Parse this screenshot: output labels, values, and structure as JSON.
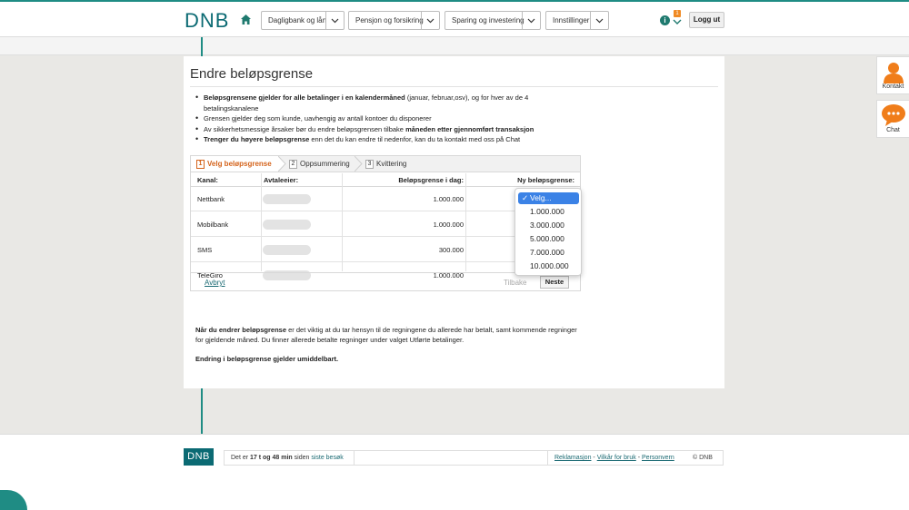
{
  "header": {
    "logo": "DNB",
    "nav": [
      {
        "label": "Dagligbank og lån"
      },
      {
        "label": "Pensjon og forsikring"
      },
      {
        "label": "Sparing og investering"
      },
      {
        "label": "Innstillinger"
      }
    ],
    "notification_count": "1",
    "logout_label": "Logg ut"
  },
  "page": {
    "title": "Endre beløpsgrense",
    "bullets": [
      {
        "bold": "Beløpsgrensene gjelder for alle betalinger i en kalendermåned",
        "text": " (januar, februar,osv), og for hver av de 4 betalingskanalene"
      },
      {
        "bold": "",
        "text": "Grensen gjelder deg som kunde, uavhengig av antall kontoer du disponerer"
      },
      {
        "text_before": "Av sikkerhetsmessige årsaker bør du endre beløpsgrensen tilbake ",
        "bold": "måneden etter gjennomført transaksjon",
        "text": ""
      },
      {
        "bold": "Trenger du høyere beløpsgrense",
        "text": " enn det du kan endre til nedenfor, kan du ta kontakt med oss på Chat"
      }
    ]
  },
  "wizard": {
    "steps": [
      {
        "num": "1",
        "label": "Velg beløpsgrense"
      },
      {
        "num": "2",
        "label": "Oppsummering"
      },
      {
        "num": "3",
        "label": "Kvittering"
      }
    ],
    "columns": [
      "Kanal:",
      "Avtaleeier:",
      "Beløpsgrense i dag:",
      "Ny beløpsgrense:"
    ],
    "rows": [
      {
        "channel": "Nettbank",
        "limit": "1.000.000"
      },
      {
        "channel": "Mobilbank",
        "limit": "1.000.000"
      },
      {
        "channel": "SMS",
        "limit": "300.000"
      },
      {
        "channel": "TeleGiro",
        "limit": "1.000.000"
      }
    ],
    "abort_label": "Avbryt",
    "back_label": "Tilbake",
    "next_label": "Neste"
  },
  "dropdown": {
    "selected": "Velg...",
    "options": [
      "Velg...",
      "1.000.000",
      "3.000.000",
      "5.000.000",
      "7.000.000",
      "10.000.000"
    ]
  },
  "notes": {
    "para1_bold": "Når du endrer beløpsgrense",
    "para1_text": " er det viktig at du tar hensyn til de regningene du allerede har betalt, samt kommende regninger for gjeldende måned. Du finner allerede betalte regninger under valget Utførte betalinger.",
    "para2": "Endring i beløpsgrense gjelder umiddelbart."
  },
  "footer": {
    "logo": "DNB",
    "since_prefix": "Det er ",
    "since_time": "17 t og 48 min",
    "since_mid": " siden ",
    "since_link": "siste besøk",
    "links": [
      "Reklamasjon",
      "Vilkår for bruk",
      "Personvern"
    ],
    "copyright": "© DNB"
  },
  "side": {
    "contact_label": "Kontakt",
    "chat_label": "Chat"
  },
  "colors": {
    "brand_teal": "#0b6a73",
    "accent_orange": "#d4631b",
    "select_blue": "#3b82e6"
  }
}
